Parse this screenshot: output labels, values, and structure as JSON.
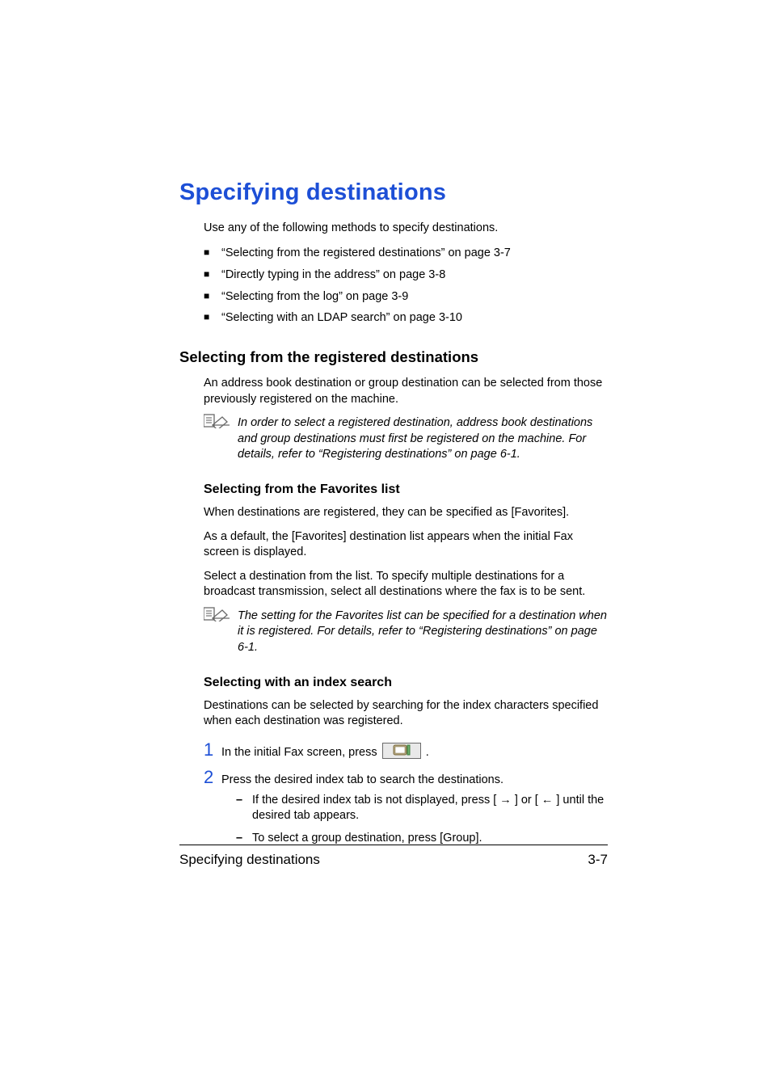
{
  "heading": "Specifying destinations",
  "intro": "Use any of the following methods to specify destinations.",
  "bullets": [
    "“Selecting from the registered destinations” on page 3-7",
    "“Directly typing in the address” on page 3-8",
    "“Selecting from the log” on page 3-9",
    "“Selecting with an LDAP search” on page 3-10"
  ],
  "sec1": {
    "title": "Selecting from the registered destinations",
    "p1": "An address book destination or group destination can be selected from those previously registered on the machine.",
    "note": "In order to select a registered destination, address book destinations and group destinations must first be registered on the machine. For details, refer to “Registering destinations” on page 6-1."
  },
  "sec2": {
    "title": "Selecting from the Favorites list",
    "p1": "When destinations are registered, they can be specified as [Favorites].",
    "p2": "As a default, the [Favorites] destination list appears when the initial Fax screen is displayed.",
    "p3": "Select a destination from the list. To specify multiple destinations for a broadcast transmission, select all destinations where the fax is to be sent.",
    "note": "The setting for the Favorites list can be specified for a destination when it is registered. For details, refer to “Registering destinations” on page 6-1."
  },
  "sec3": {
    "title": "Selecting with an index search",
    "p1": "Destinations can be selected by searching for the index characters specified when each destination was registered.",
    "step1_pre": "In the initial Fax screen, press ",
    "step1_post": ".",
    "step2": "Press the desired index tab to search the destinations.",
    "dash1": "If the desired index tab is not displayed, press [ → ] or [ ← ] until the desired tab appears.",
    "dash2": "To select a group destination, press [Group]."
  },
  "footer": {
    "left": "Specifying destinations",
    "right": "3-7"
  }
}
